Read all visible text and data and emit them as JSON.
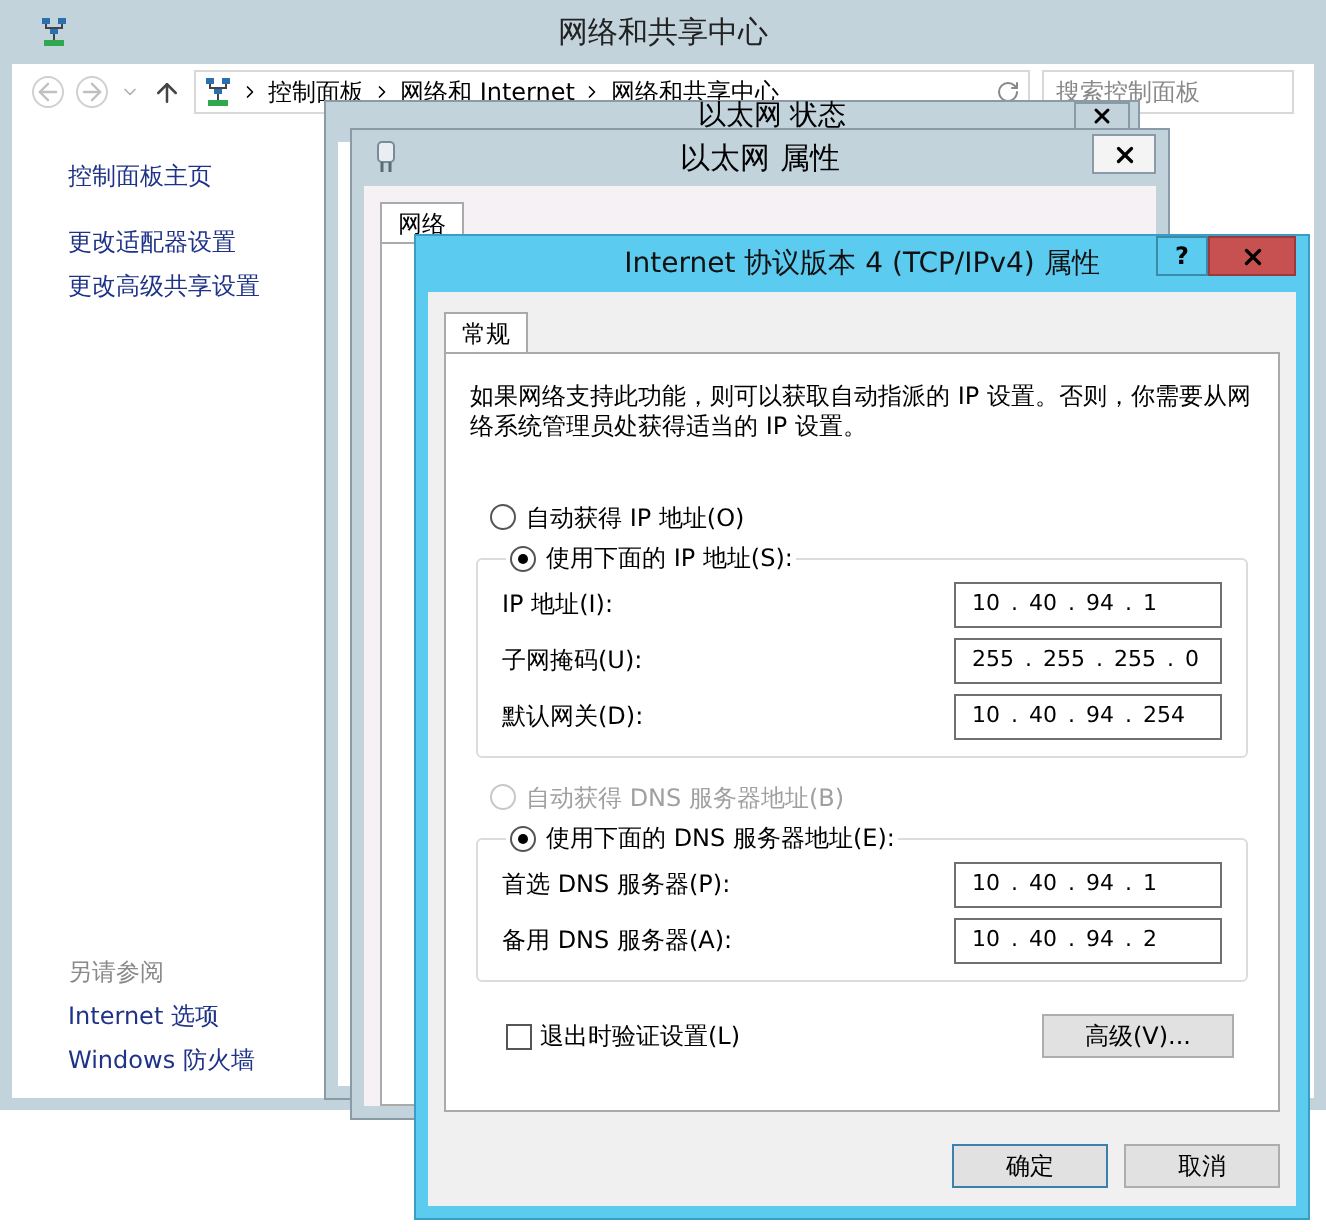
{
  "background_window": {
    "title": "网络和共享中心",
    "breadcrumb": [
      "控制面板",
      "网络和 Internet",
      "网络和共享中心"
    ],
    "search": {
      "placeholder": "搜索控制面板"
    },
    "sidebar_links": [
      "控制面板主页",
      "更改适配器设置",
      "更改高级共享设置"
    ],
    "see_also": {
      "heading": "另请参阅",
      "links": [
        "Internet 选项",
        "Windows 防火墙"
      ]
    }
  },
  "status_window": {
    "title": "以太网 状态"
  },
  "properties_window": {
    "title": "以太网 属性",
    "tabs": [
      {
        "label": "网络",
        "selected": true
      }
    ]
  },
  "dialog": {
    "title": "Internet 协议版本 4 (TCP/IPv4) 属性",
    "help_button": "?",
    "tabs": [
      {
        "label": "常规",
        "selected": true
      }
    ],
    "description": "如果网络支持此功能，则可以获取自动指派的 IP 设置。否则，你需要从网络系统管理员处获得适当的 IP 设置。",
    "ip_options": [
      {
        "label": "自动获得 IP 地址(O)",
        "selected": false,
        "disabled": false
      },
      {
        "label": "使用下面的 IP 地址(S):",
        "selected": true,
        "disabled": false
      }
    ],
    "ip_fields": [
      {
        "label": "IP 地址(I):",
        "value": "10 . 40 . 94 . 1"
      },
      {
        "label": "子网掩码(U):",
        "value": "255 . 255 . 255 . 0"
      },
      {
        "label": "默认网关(D):",
        "value": "10 . 40 . 94 . 254"
      }
    ],
    "dns_options": [
      {
        "label": "自动获得 DNS 服务器地址(B)",
        "selected": false,
        "disabled": true
      },
      {
        "label": "使用下面的 DNS 服务器地址(E):",
        "selected": true,
        "disabled": false
      }
    ],
    "dns_fields": [
      {
        "label": "首选 DNS 服务器(P):",
        "value": "10 . 40 . 94 . 1"
      },
      {
        "label": "备用 DNS 服务器(A):",
        "value": "10 . 40 . 94 . 2"
      }
    ],
    "validate": {
      "label": "退出时验证设置(L)",
      "checked": false
    },
    "advanced_button": "高级(V)...",
    "buttons": [
      {
        "label": "确定",
        "default": true
      },
      {
        "label": "取消",
        "default": false
      }
    ]
  }
}
